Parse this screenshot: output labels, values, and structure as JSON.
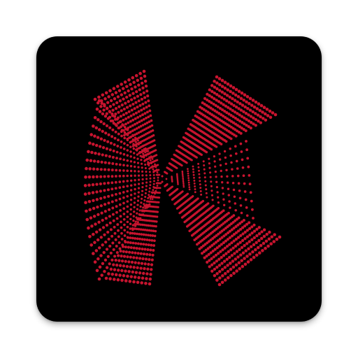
{
  "app_icon": {
    "glyph": "dotted-k-logo",
    "background_color": "#000000",
    "dot_color": "#c8142f"
  }
}
